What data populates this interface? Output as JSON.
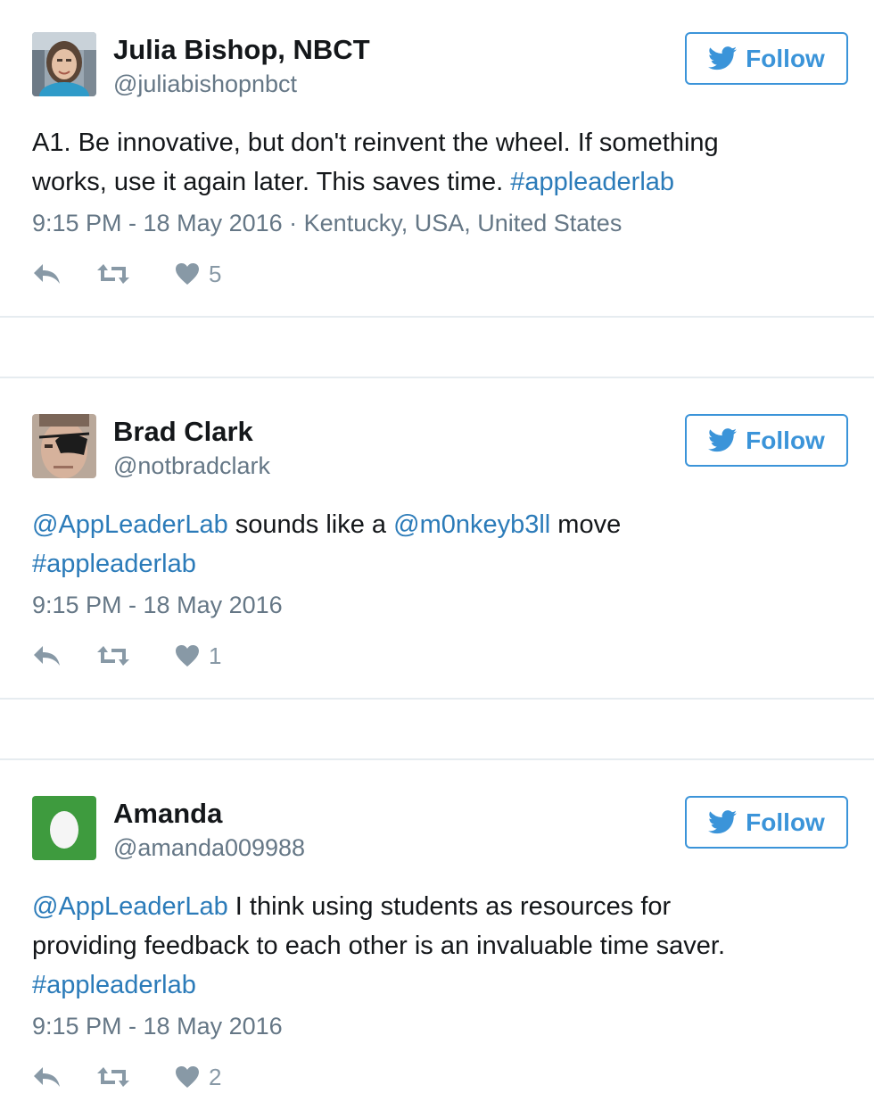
{
  "tweets": [
    {
      "name": "Julia Bishop, NBCT",
      "handle": "@juliabishopnbct",
      "follow_label": "Follow",
      "text_lines": [
        [
          {
            "t": "A1. Be innovative, but don't reinvent the wheel. If something",
            "link": false
          }
        ],
        [
          {
            "t": "works, use it again later. This saves time. ",
            "link": false
          },
          {
            "t": "#appleaderlab",
            "link": true
          }
        ]
      ],
      "timestamp": "9:15 PM - 18 May 2016 · Kentucky, USA, United States",
      "likes": "5",
      "avatar": "photo-woman"
    },
    {
      "name": "Brad Clark",
      "handle": "@notbradclark",
      "follow_label": "Follow",
      "text_lines": [
        [
          {
            "t": "@AppLeaderLab",
            "link": true
          },
          {
            "t": " sounds like a ",
            "link": false
          },
          {
            "t": "@m0nkeyb3ll",
            "link": true
          },
          {
            "t": " move",
            "link": false
          }
        ],
        [
          {
            "t": "#appleaderlab",
            "link": true
          }
        ]
      ],
      "timestamp": "9:15 PM - 18 May 2016",
      "likes": "1",
      "avatar": "photo-man-eyepatch"
    },
    {
      "name": "Amanda",
      "handle": "@amanda009988",
      "follow_label": "Follow",
      "text_lines": [
        [
          {
            "t": "@AppLeaderLab",
            "link": true
          },
          {
            "t": " I think using students as resources for",
            "link": false
          }
        ],
        [
          {
            "t": "providing feedback to each other is an invaluable time saver.",
            "link": false
          }
        ],
        [
          {
            "t": "#appleaderlab",
            "link": true
          }
        ]
      ],
      "timestamp": "9:15 PM - 18 May 2016",
      "likes": "2",
      "avatar": "egg-default"
    }
  ],
  "colors": {
    "accent": "#3b94d9",
    "link": "#2b7bb9",
    "muted": "#657786",
    "icon": "#8899a6",
    "egg_bg": "#3e9b3e"
  },
  "icons": [
    "twitter-bird-icon",
    "reply-icon",
    "retweet-icon",
    "heart-icon"
  ]
}
